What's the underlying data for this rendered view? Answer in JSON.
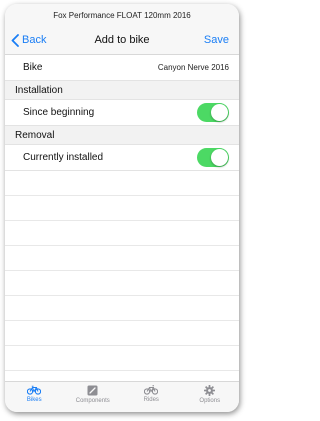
{
  "status": {
    "title": "Fox Performance FLOAT 120mm 2016"
  },
  "nav": {
    "back_label": "Back",
    "title": "Add to bike",
    "save_label": "Save"
  },
  "bike_row": {
    "label": "Bike",
    "value": "Canyon Nerve 2016"
  },
  "installation": {
    "header": "Installation",
    "row_label": "Since beginning",
    "toggle_on": true
  },
  "removal": {
    "header": "Removal",
    "row_label": "Currently installed",
    "toggle_on": true
  },
  "tabs": [
    {
      "label": "Bikes",
      "icon": "bike-icon",
      "active": true
    },
    {
      "label": "Components",
      "icon": "component-icon",
      "active": false
    },
    {
      "label": "Rides",
      "icon": "ride-icon",
      "active": false
    },
    {
      "label": "Options",
      "icon": "gear-icon",
      "active": false
    }
  ],
  "colors": {
    "accent": "#1a7ef5",
    "toggle_on": "#4cd964",
    "tab_inactive": "#8e8e93"
  }
}
